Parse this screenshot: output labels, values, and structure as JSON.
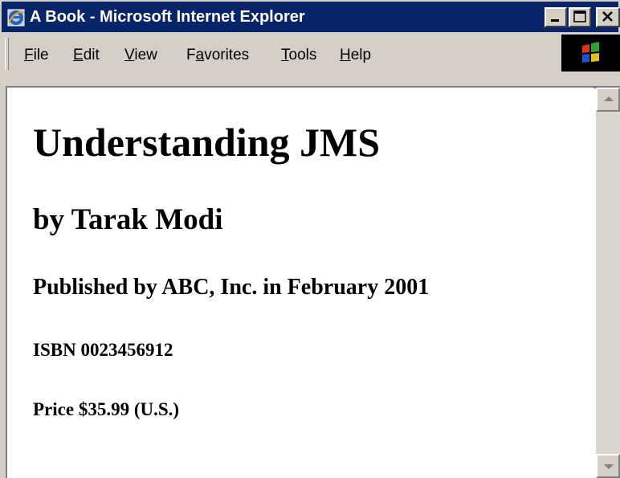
{
  "window": {
    "title": "A Book - Microsoft Internet Explorer",
    "icon": "ie-icon",
    "buttons": [
      "minimize",
      "maximize",
      "close"
    ]
  },
  "menu": {
    "items": [
      {
        "label": "File",
        "access_key": "F"
      },
      {
        "label": "Edit",
        "access_key": "E"
      },
      {
        "label": "View",
        "access_key": "V"
      },
      {
        "label": "Favorites",
        "access_key": "a"
      },
      {
        "label": "Tools",
        "access_key": "T"
      },
      {
        "label": "Help",
        "access_key": "H"
      }
    ]
  },
  "page": {
    "title": "Understanding JMS",
    "author": "by Tarak Modi",
    "publisher": "Published by ABC, Inc. in February 2001",
    "isbn": "ISBN 0023456912",
    "price": "Price $35.99 (U.S.)"
  },
  "colors": {
    "title_bar": "#0a246a",
    "chrome": "#d4d0c8",
    "content_background": "#ffffff"
  }
}
